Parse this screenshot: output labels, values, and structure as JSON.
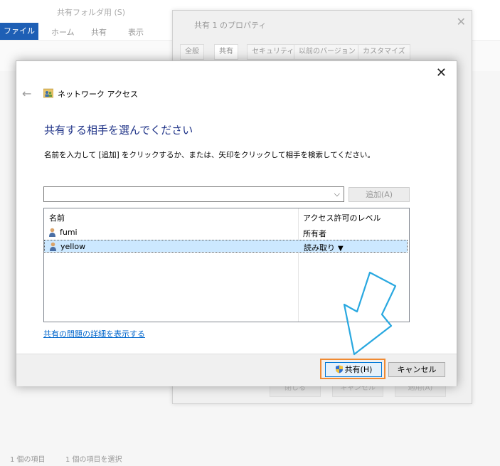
{
  "explorer": {
    "title": "共有フォルダ用 (S)",
    "tabs": [
      "ファイル",
      "ホーム",
      "共有",
      "表示"
    ],
    "status_items": "1 個の項目",
    "status_selected": "1 個の項目を選択"
  },
  "properties": {
    "title": "共有 1 のプロパティ",
    "tabs": [
      "全般",
      "共有",
      "セキュリティ",
      "以前のバージョン",
      "カスタマイズ"
    ],
    "buttons": [
      "閉じる",
      "キャンセル",
      "適用(A)"
    ]
  },
  "dialog": {
    "nav_title": "ネットワーク アクセス",
    "heading": "共有する相手を選んでください",
    "instruction": "名前を入力して [追加] をクリックするか、または、矢印をクリックして相手を検索してください。",
    "input_value": "",
    "add_button": "追加(A)",
    "columns": {
      "name": "名前",
      "permission": "アクセス許可のレベル"
    },
    "rows": [
      {
        "name": "fumi",
        "permission": "所有者",
        "selected": false
      },
      {
        "name": "yellow",
        "permission": "読み取り",
        "selected": true
      }
    ],
    "help_link": "共有の問題の詳細を表示する",
    "share_button": "共有(H)",
    "cancel_button": "キャンセル"
  },
  "colors": {
    "heading": "#1e3287",
    "highlight": "#f08a32",
    "annotation_arrow": "#29a8e0",
    "selection": "#cce8ff"
  }
}
